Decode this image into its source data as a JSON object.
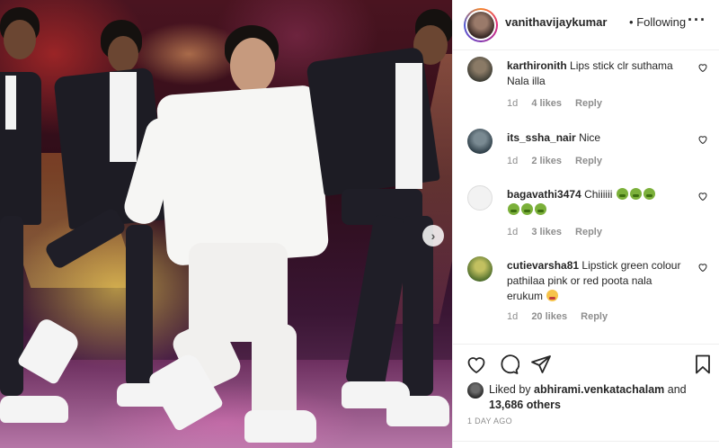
{
  "post": {
    "username": "vanithavijaykumar",
    "follow_separator": "•",
    "follow_label": "Following",
    "more_icon": "more-options-icon"
  },
  "comments": [
    {
      "user": "karthironith",
      "text": "Lips stick clr suthama Nala illa",
      "time": "1d",
      "likes": "4 likes",
      "reply": "Reply",
      "avatar_color": "#5a5a4a"
    },
    {
      "user": "its_ssha_nair",
      "text": "Nice",
      "time": "1d",
      "likes": "2 likes",
      "reply": "Reply",
      "avatar_color": "#3a5a6a"
    },
    {
      "user": "bagavathi3474",
      "text": "Chiiiiii",
      "time": "1d",
      "likes": "3 likes",
      "reply": "Reply",
      "avatar_color": "#e8e8e8"
    },
    {
      "user": "cutievarsha81",
      "text": "Lipstick green colour pathilaa pink or red poota nala erukum",
      "time": "1d",
      "likes": "20 likes",
      "reply": "Reply",
      "avatar_color": "#8aa23a"
    }
  ],
  "actions": {
    "like_icon": "heart-icon",
    "comment_icon": "comment-icon",
    "share_icon": "share-icon",
    "save_icon": "bookmark-icon"
  },
  "likes": {
    "prefix": "Liked by",
    "user": "abhirami.venkatachalam",
    "and": "and",
    "others": "13,686 others"
  },
  "timestamp": "1 DAY AGO",
  "colors": {
    "text": "#262626",
    "muted": "#8e8e8e",
    "border": "#efefef"
  }
}
